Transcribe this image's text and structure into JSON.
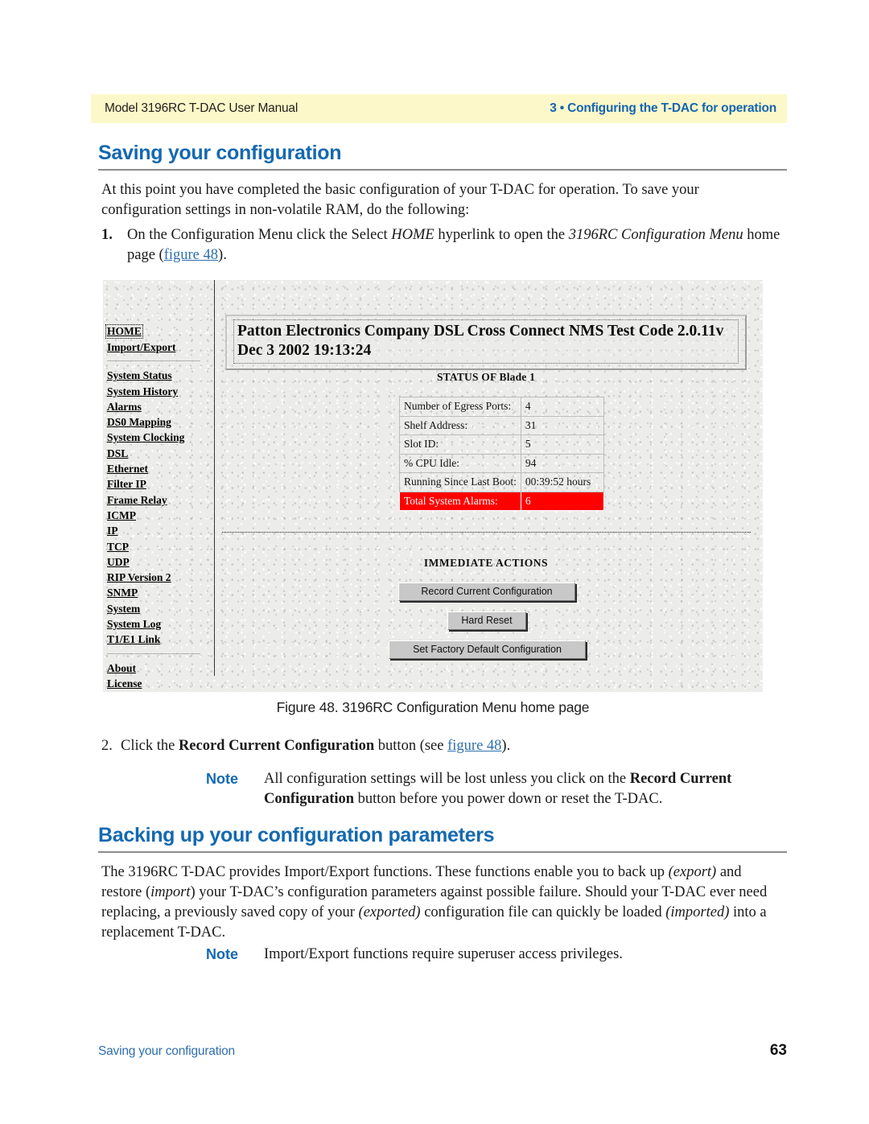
{
  "header": {
    "left": "Model 3196RC T-DAC User Manual",
    "right": "3 • Configuring the T-DAC for operation"
  },
  "section1": {
    "heading": "Saving your configuration",
    "intro": "At this point you have completed the basic configuration of your T-DAC for operation. To save your configuration settings in non-volatile RAM, do the following:",
    "step1": {
      "number": "1.",
      "text_a": "On the Configuration Menu click the Select ",
      "italic_a": "HOME",
      "text_b": " hyperlink to open the ",
      "italic_b": "3196RC Configuration Menu",
      "text_c": " home page (",
      "xref": "figure 48",
      "text_d": ")."
    },
    "step2": {
      "number": "2.",
      "text_a": "Click the ",
      "bold_a": "Record Current Configuration",
      "text_b": " button (see ",
      "xref": "figure 48",
      "text_c": ")."
    },
    "note": {
      "label": "Note",
      "text_a": "All configuration settings will be lost unless you click on the ",
      "bold_a": "Record Current Configuration",
      "text_b": " button before you power down or reset the T-DAC."
    }
  },
  "figure": {
    "caption": "Figure 48. 3196RC Configuration Menu home page",
    "banner": {
      "line1": "Patton Electronics Company DSL Cross Connect NMS Test Code 2.0.11v",
      "line2": "Dec 3 2002 19:13:24"
    },
    "sidebar": {
      "group1": [
        "HOME",
        "Import/Export"
      ],
      "group2": [
        "System Status",
        "System History",
        "Alarms",
        "DS0 Mapping",
        "System Clocking",
        "DSL",
        "Ethernet",
        "Filter IP",
        "Frame Relay",
        "ICMP",
        "IP",
        "TCP",
        "UDP",
        "RIP Version 2",
        "SNMP",
        "System",
        "System Log",
        "T1/E1 Link"
      ],
      "group3": [
        "About",
        "License"
      ]
    },
    "status": {
      "title": "STATUS OF Blade 1",
      "rows": [
        {
          "label": "Number of Egress Ports:",
          "value": "4"
        },
        {
          "label": "Shelf Address:",
          "value": "31"
        },
        {
          "label": "Slot ID:",
          "value": "5"
        },
        {
          "label": "% CPU Idle:",
          "value": "94"
        },
        {
          "label": "Running Since Last Boot:",
          "value": "00:39:52 hours"
        },
        {
          "label": "Total System Alarms:",
          "value": "6",
          "alarm": true
        }
      ],
      "alarm_bg": "#ff0000"
    },
    "actions": {
      "title": "IMMEDIATE ACTIONS",
      "buttons": [
        "Record Current Configuration",
        "Hard Reset",
        "Set Factory Default Configuration"
      ]
    }
  },
  "section2": {
    "heading": "Backing up your configuration parameters",
    "para": {
      "t1": "The 3196RC T-DAC provides Import/Export functions. These functions enable you to back up ",
      "i1": "(export)",
      "t2": " and restore (",
      "i2": "import",
      "t3": ") your T-DAC’s configuration parameters against possible failure. Should your T-DAC ever need replacing, a previously saved copy of your ",
      "i3": "(exported)",
      "t4": " configuration file can quickly be loaded ",
      "i4": "(imported)",
      "t5": " into a replacement T-DAC."
    },
    "note": {
      "label": "Note",
      "text": "Import/Export functions require superuser access privileges."
    }
  },
  "footer": {
    "left": "Saving your configuration",
    "page": "63"
  }
}
